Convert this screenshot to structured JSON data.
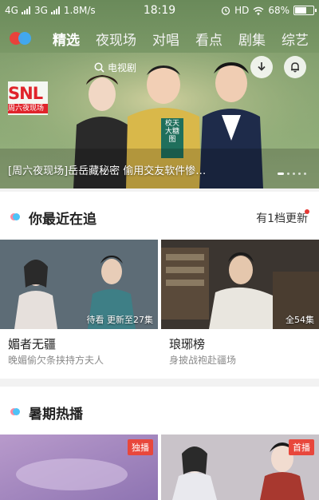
{
  "status_bar": {
    "network1": "4G",
    "network2": "3G",
    "speed": "1.8M/s",
    "time": "18:19",
    "hd": "HD",
    "battery": "68%",
    "battery_level": 0.68
  },
  "nav": {
    "tabs": [
      {
        "label": "精选",
        "active": true
      },
      {
        "label": "夜现场",
        "active": false
      },
      {
        "label": "对唱",
        "active": false
      },
      {
        "label": "看点",
        "active": false
      },
      {
        "label": "剧集",
        "active": false
      },
      {
        "label": "综艺",
        "active": false
      }
    ]
  },
  "banner": {
    "search_placeholder": "电视剧",
    "caption": "[周六夜现场]岳岳藏秘密 偷用交友软件惨…",
    "logo_text": "SNL",
    "logo_sub": "周六夜现场",
    "sign_text": "校天大糖图"
  },
  "recent": {
    "title": "你最近在追",
    "more": "有1档更新",
    "cards": [
      {
        "name": "媚者无疆",
        "desc": "晚媚偷欠条挟持方夫人",
        "overlay": "待看 更新至27集"
      },
      {
        "name": "琅琊榜",
        "desc": "身披战袍赴疆场",
        "overlay": "全54集"
      }
    ]
  },
  "summer": {
    "title": "暑期热播",
    "cards": [
      {
        "badge": "独播"
      },
      {
        "badge": "首播"
      }
    ]
  },
  "colors": {
    "header_green": "#7f9c6a",
    "accent_red": "#e8473c",
    "logo_red": "#e8423b",
    "logo_blue": "#3fa9f5"
  }
}
